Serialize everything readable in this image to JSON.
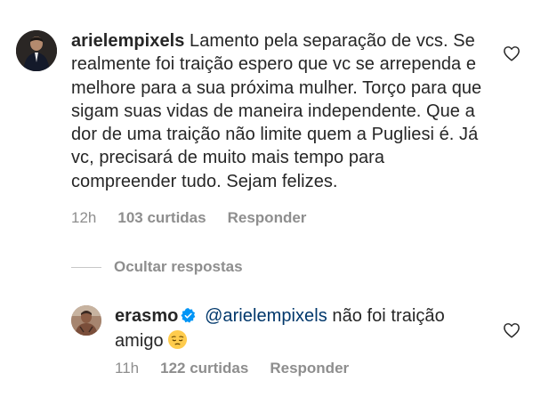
{
  "comment": {
    "username": "arielempixels",
    "text": "Lamento pela separação de vcs. Se realmente foi traição espero que vc se arrependa e melhore para a sua próxima mulher. Torço para que sigam suas vidas de maneira independente. Que a dor de uma traição não limite quem a Pugliesi é. Já vc, precisará de muito mais tempo para compreender tudo. Sejam felizes.",
    "time": "12h",
    "likes": "103 curtidas",
    "reply_label": "Responder"
  },
  "hide_replies_label": "Ocultar respostas",
  "reply": {
    "username": "erasmo",
    "verified": true,
    "mention": "@arielempixels",
    "text": "não foi traição amigo",
    "emoji": "pensive-face",
    "time": "11h",
    "likes": "122 curtidas",
    "reply_label": "Responder"
  },
  "colors": {
    "text": "#262626",
    "secondary": "#8e8e8e",
    "mention": "#00376b",
    "verified": "#0095f6"
  }
}
